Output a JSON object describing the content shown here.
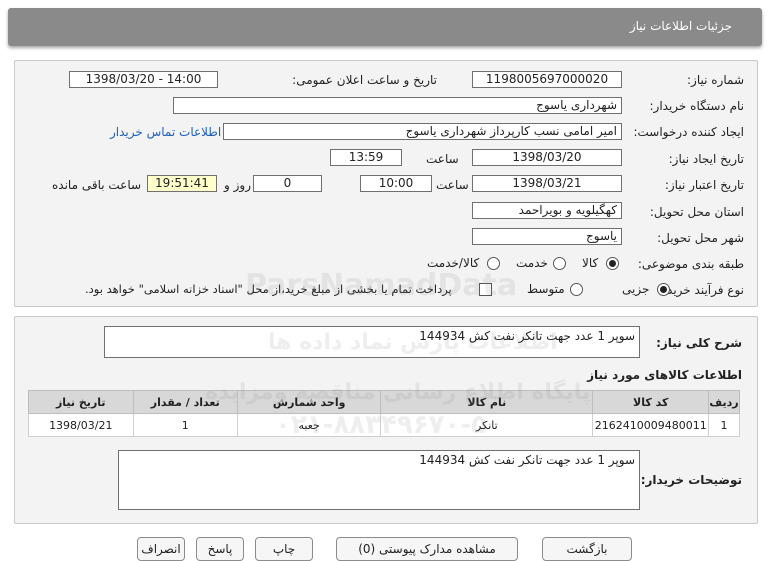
{
  "header": {
    "title": "جزئیات اطلاعات نیاز"
  },
  "form": {
    "need_number_label": "شماره نیاز:",
    "need_number": "1198005697000020",
    "announce_label": "تاریخ و ساعت اعلان عمومی:",
    "announce_value": "1398/03/20 - 14:00",
    "buyer_org_label": "نام دستگاه خریدار:",
    "buyer_org": "شهرداری یاسوج",
    "creator_label": "ایجاد کننده درخواست:",
    "creator": "امیر امامی نسب کارپرداز شهرداری یاسوج",
    "contact_link": "اطلاعات تماس خریدار",
    "created_label": "تاریخ ایجاد نیاز:",
    "created_date": "1398/03/20",
    "time_label": "ساعت",
    "created_time": "13:59",
    "validity_label": "تاریخ اعتبار نیاز:",
    "validity_date": "1398/03/21",
    "validity_time": "10:00",
    "days_value": "0",
    "days_label": "روز و",
    "remaining_time": "19:51:41",
    "remaining_label": "ساعت باقی مانده",
    "province_label": "استان محل تحویل:",
    "province": "کهگیلویه و بویراحمد",
    "city_label": "شهر محل تحویل:",
    "city": "یاسوج",
    "category_label": "طبقه بندی موضوعی:",
    "category_options": [
      "کالا",
      "خدمت",
      "کالا/خدمت"
    ],
    "category_selected": "کالا",
    "process_label": "نوع فرآیند خرید :",
    "process_options": [
      "جزیی",
      "متوسط"
    ],
    "process_selected": "جزیی",
    "payment_note": "پرداخت تمام یا بخشی از مبلغ خرید،از محل \"اسناد خزانه اسلامی\" خواهد بود."
  },
  "summary": {
    "label": "شرح کلی نیاز:",
    "value": "سوپر 1 عدد جهت تانکر نفت کش 144934"
  },
  "goods": {
    "title": "اطلاعات کالاهای مورد نیاز",
    "columns": [
      "ردیف",
      "کد کالا",
      "نام کالا",
      "واحد شمارش",
      "تعداد / مقدار",
      "تاریخ نیاز"
    ],
    "rows": [
      [
        "1",
        "2162410009480011",
        "تانکر",
        "جعبه",
        "1",
        "1398/03/21"
      ]
    ]
  },
  "buyer_notes": {
    "label": "توضیحات خریدار:",
    "value": "سوپر 1 عدد جهت تانکر نفت کش 144934"
  },
  "watermark": {
    "brand": "ParsNamadData",
    "line1": "اطلاعات پارس نماد داده ها",
    "line2": "پایگاه اطلاع رسانی مناقصه ومزایده",
    "line3": "۰۲۱-۸۸۳۴۹۶۷۰-۵"
  },
  "buttons": {
    "b1": "بازگشت",
    "b2": "مشاهده مدارک پیوستی (0)",
    "b3": "چاپ",
    "b4": "پاسخ",
    "b5": "انصراف"
  }
}
